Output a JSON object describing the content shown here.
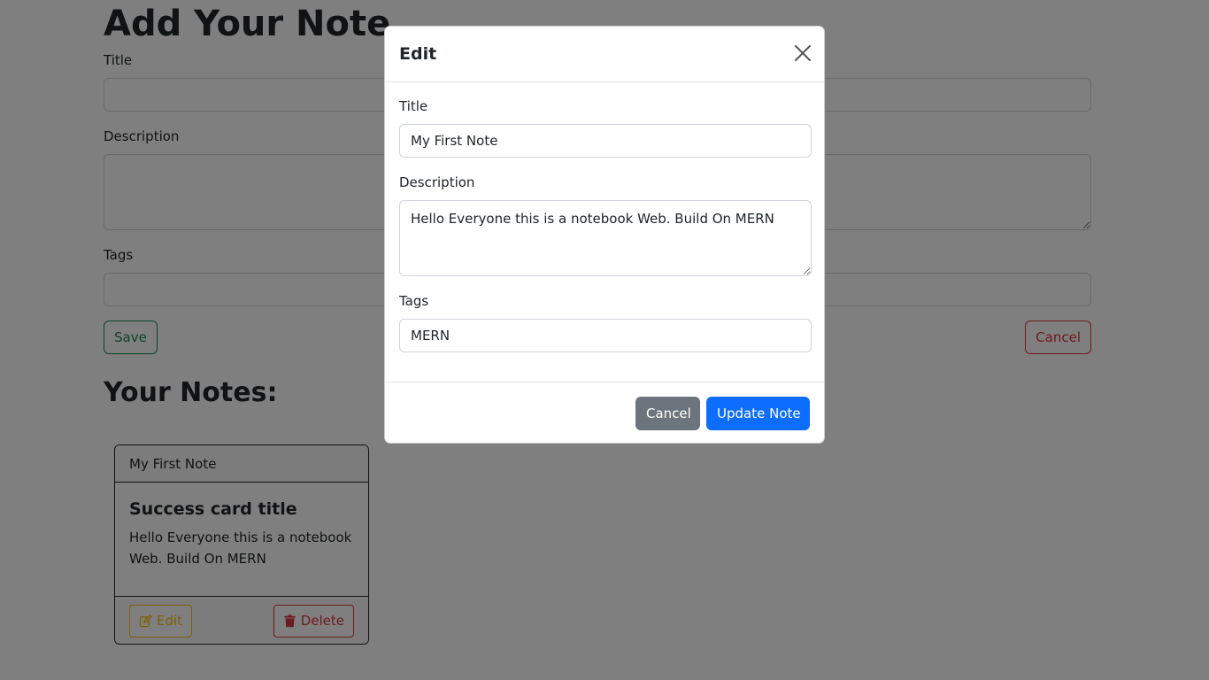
{
  "add_note": {
    "heading": "Add Your Note",
    "title_label": "Title",
    "description_label": "Description",
    "tags_label": "Tags",
    "save_label": "Save",
    "cancel_label": "Cancel"
  },
  "notes": {
    "heading": "Your Notes:",
    "cards": [
      {
        "header": "My First Note",
        "title": "Success card title",
        "text": "Hello Everyone this is a notebook Web. Build On MERN",
        "edit_label": "Edit",
        "delete_label": "Delete",
        "edit_icon": "edit-icon",
        "delete_icon": "trash-icon"
      }
    ]
  },
  "modal": {
    "title": "Edit",
    "close_icon": "close-icon",
    "title_label": "Title",
    "title_value": "My First Note",
    "description_label": "Description",
    "description_value": "Hello Everyone this is a notebook Web. Build On MERN",
    "tags_label": "Tags",
    "tags_value": "MERN",
    "cancel_label": "Cancel",
    "update_label": "Update Note"
  },
  "colors": {
    "success": "#198754",
    "danger": "#dc3545",
    "warning": "#ffc107",
    "primary": "#0d6efd",
    "secondary": "#6c757d"
  }
}
